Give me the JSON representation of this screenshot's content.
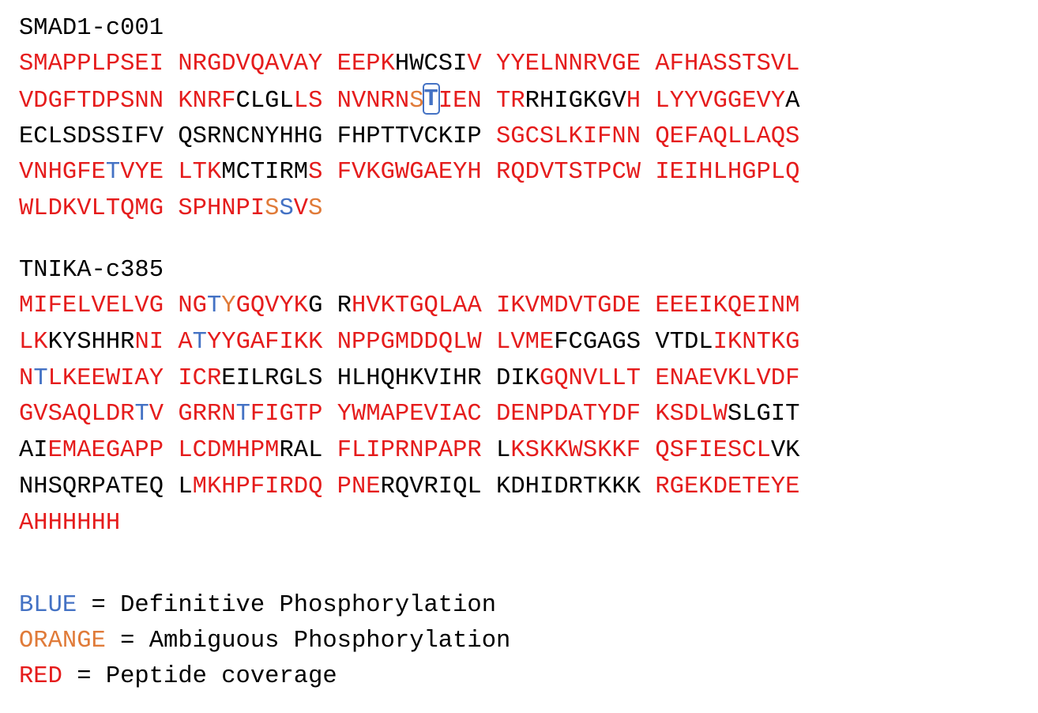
{
  "proteins": [
    {
      "name": "SMAD1-c001",
      "lines": [
        [
          {
            "t": "SMAPPLPSEI NRGDVQAVAY EEPK",
            "c": "r"
          },
          {
            "t": "HWCSI",
            "c": "k"
          },
          {
            "t": "V YYELNNRVGE AFHASSTSVL",
            "c": "r"
          }
        ],
        [
          {
            "t": "VDGFTDPSNN KNRF",
            "c": "r"
          },
          {
            "t": "CLGL",
            "c": "k"
          },
          {
            "t": "LS NVNRN",
            "c": "r"
          },
          {
            "t": "S",
            "c": "o"
          },
          {
            "t": "T",
            "c": "bx"
          },
          {
            "t": "IEN TR",
            "c": "r"
          },
          {
            "t": "RHIGKGV",
            "c": "k"
          },
          {
            "t": "H LYYVGGEVY",
            "c": "r"
          },
          {
            "t": "A",
            "c": "k"
          }
        ],
        [
          {
            "t": "ECLSDSSIFV QSRNCNYHHG FHPTTVCKIP ",
            "c": "k"
          },
          {
            "t": "SGCSLKIFNN QEFAQLLAQS",
            "c": "r"
          }
        ],
        [
          {
            "t": "VNHGFE",
            "c": "r"
          },
          {
            "t": "T",
            "c": "b"
          },
          {
            "t": "VYE LTK",
            "c": "r"
          },
          {
            "t": "MCTIRM",
            "c": "k"
          },
          {
            "t": "S FVKGWGAEYH RQDVTSTPCW IEIHLHGPLQ",
            "c": "r"
          }
        ],
        [
          {
            "t": "WLDKVLTQMG SPHNPI",
            "c": "r"
          },
          {
            "t": "S",
            "c": "o"
          },
          {
            "t": "S",
            "c": "b"
          },
          {
            "t": "V",
            "c": "r"
          },
          {
            "t": "S",
            "c": "o"
          }
        ]
      ]
    },
    {
      "name": "TNIKA-c385",
      "lines": [
        [
          {
            "t": "MIFELVELVG NG",
            "c": "r"
          },
          {
            "t": "T",
            "c": "b"
          },
          {
            "t": "Y",
            "c": "o"
          },
          {
            "t": "GQVYK",
            "c": "r"
          },
          {
            "t": "G R",
            "c": "k"
          },
          {
            "t": "HVKTGQLAA IKVMDVTGDE EEEIKQEINM",
            "c": "r"
          }
        ],
        [
          {
            "t": "LK",
            "c": "r"
          },
          {
            "t": "KYSHHR",
            "c": "k"
          },
          {
            "t": "NI A",
            "c": "r"
          },
          {
            "t": "T",
            "c": "b"
          },
          {
            "t": "YYGAFIKK NPPGMDDQLW LVME",
            "c": "r"
          },
          {
            "t": "FCGAGS VTDL",
            "c": "k"
          },
          {
            "t": "IKNTKG",
            "c": "r"
          }
        ],
        [
          {
            "t": "N",
            "c": "r"
          },
          {
            "t": "T",
            "c": "b"
          },
          {
            "t": "LKEEWIAY ICR",
            "c": "r"
          },
          {
            "t": "EILRGLS HLHQHKVIHR DIK",
            "c": "k"
          },
          {
            "t": "GQNVLLT ENAEVKLVDF",
            "c": "r"
          }
        ],
        [
          {
            "t": "GVSAQLDR",
            "c": "r"
          },
          {
            "t": "T",
            "c": "b"
          },
          {
            "t": "V GRRN",
            "c": "r"
          },
          {
            "t": "T",
            "c": "b"
          },
          {
            "t": "FIGTP YWMAPEVIAC DENPDATYDF KSDLW",
            "c": "r"
          },
          {
            "t": "SLGIT",
            "c": "k"
          }
        ],
        [
          {
            "t": "AI",
            "c": "k"
          },
          {
            "t": "EMAEGAPP LCDMHPM",
            "c": "r"
          },
          {
            "t": "RAL",
            "c": "k"
          },
          {
            "t": " FLIPRNPAPR ",
            "c": "r"
          },
          {
            "t": "L",
            "c": "k"
          },
          {
            "t": "KSKKWSKKF QSFIESCL",
            "c": "r"
          },
          {
            "t": "VK",
            "c": "k"
          }
        ],
        [
          {
            "t": "NHSQRPATEQ L",
            "c": "k"
          },
          {
            "t": "MKHPFIRDQ PNE",
            "c": "r"
          },
          {
            "t": "RQVRIQL KDHIDRTKKK ",
            "c": "k"
          },
          {
            "t": "RGEKDETEYE",
            "c": "r"
          }
        ],
        [
          {
            "t": "AHHHHHH",
            "c": "r"
          }
        ]
      ]
    }
  ],
  "legend": [
    {
      "key": "BLUE",
      "text": " = Definitive Phosphorylation",
      "color": "#4472c4"
    },
    {
      "key": "ORANGE",
      "text": " = Ambiguous Phosphorylation",
      "color": "#e07b39"
    },
    {
      "key": "RED",
      "text": " = Peptide coverage",
      "color": "#e51c1c"
    }
  ],
  "colors": {
    "red": "#e51c1c",
    "blue": "#4472c4",
    "orange": "#e07b39",
    "black": "#000000"
  }
}
